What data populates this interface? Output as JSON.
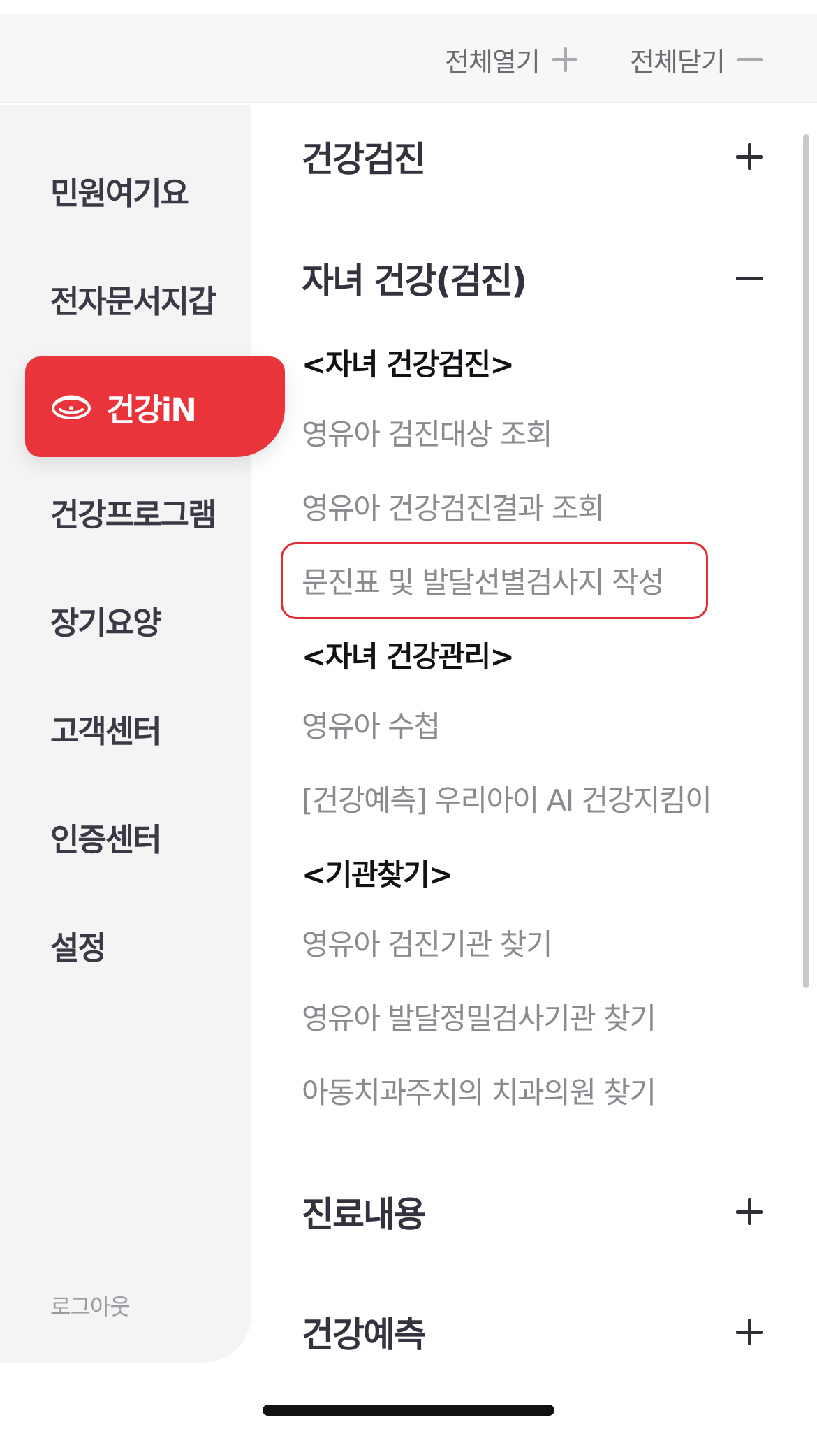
{
  "toolbar": {
    "open_all_label": "전체열기",
    "open_all_icon": "plus-icon",
    "close_all_label": "전체닫기",
    "close_all_icon": "minus-icon"
  },
  "sidebar": {
    "items": [
      {
        "label": "민원여기요"
      },
      {
        "label": "전자문서지갑"
      },
      {
        "label": "건강iN",
        "active": true,
        "icon": "health-in-logo-icon"
      },
      {
        "label": "건강프로그램"
      },
      {
        "label": "장기요양"
      },
      {
        "label": "고객센터"
      },
      {
        "label": "인증센터"
      },
      {
        "label": "설정"
      }
    ],
    "logout_label": "로그아웃",
    "active_color": "#e8343a"
  },
  "menu": {
    "sections": [
      {
        "title": "건강검진",
        "state": "collapsed"
      },
      {
        "title": "자녀 건강(검진)",
        "state": "expanded",
        "groups": [
          {
            "heading": "<자녀 건강검진>",
            "links": [
              "영유아 검진대상 조회",
              "영유아 건강검진결과 조회",
              "문진표 및 발달선별검사지 작성"
            ]
          },
          {
            "heading": "<자녀 건강관리>",
            "links": [
              "영유아 수첩",
              "[건강예측] 우리아이 AI 건강지킴이"
            ]
          },
          {
            "heading": "<기관찾기>",
            "links": [
              "영유아 검진기관 찾기",
              "영유아 발달정밀검사기관 찾기",
              "아동치과주치의 치과의원 찾기"
            ]
          }
        ]
      },
      {
        "title": "진료내용",
        "state": "collapsed"
      },
      {
        "title": "건강예측",
        "state": "collapsed"
      }
    ],
    "highlighted_link": "문진표 및 발달선별검사지 작성",
    "highlight_color": "#e02d36"
  }
}
